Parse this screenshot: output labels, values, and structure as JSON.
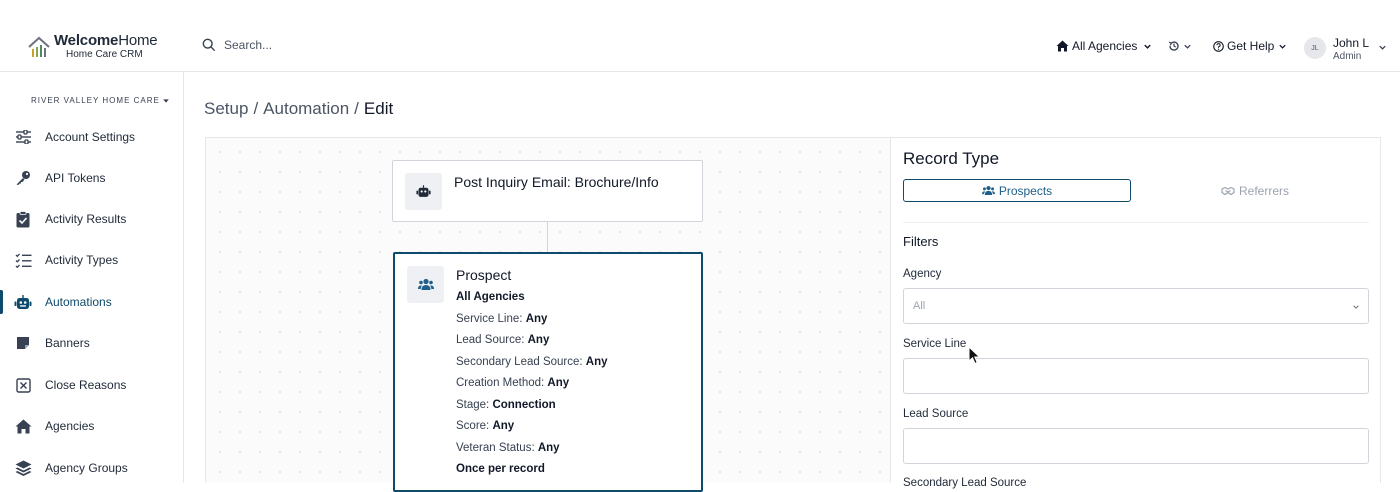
{
  "brand": {
    "name_bold": "Welcome",
    "name_rest": "Home",
    "tagline": "Home Care CRM"
  },
  "search": {
    "placeholder": "Search..."
  },
  "header": {
    "agency_selector": "All Agencies",
    "help_label": "Get Help",
    "user": {
      "initials": "JL",
      "name": "John L",
      "role": "Admin"
    }
  },
  "sidebar": {
    "org_name": "RIVER VALLEY HOME CARE",
    "items": [
      {
        "label": "Account Settings",
        "icon": "sliders-icon"
      },
      {
        "label": "API Tokens",
        "icon": "key-icon"
      },
      {
        "label": "Activity Results",
        "icon": "clipboard-check-icon"
      },
      {
        "label": "Activity Types",
        "icon": "list-check-icon"
      },
      {
        "label": "Automations",
        "icon": "robot-icon",
        "active": true
      },
      {
        "label": "Banners",
        "icon": "note-icon"
      },
      {
        "label": "Close Reasons",
        "icon": "close-box-icon"
      },
      {
        "label": "Agencies",
        "icon": "home-icon"
      },
      {
        "label": "Agency Groups",
        "icon": "layers-icon"
      }
    ]
  },
  "breadcrumb": {
    "items": [
      "Setup",
      "Automation",
      "Edit"
    ]
  },
  "flow": {
    "trigger_node": {
      "title": "Post Inquiry Email: Brochure/Info",
      "icon": "robot-icon"
    },
    "prospect_node": {
      "title": "Prospect",
      "subtitle": "All Agencies",
      "icon": "users-icon",
      "conditions": [
        {
          "label": "Service Line:",
          "value": "Any"
        },
        {
          "label": "Lead Source:",
          "value": "Any"
        },
        {
          "label": "Secondary Lead Source:",
          "value": "Any"
        },
        {
          "label": "Creation Method:",
          "value": "Any"
        },
        {
          "label": "Stage:",
          "value": "Connection"
        },
        {
          "label": "Score:",
          "value": "Any"
        },
        {
          "label": "Veteran Status:",
          "value": "Any"
        }
      ],
      "frequency": "Once per record"
    }
  },
  "panel": {
    "title": "Record Type",
    "record_types": {
      "prospects": "Prospects",
      "referrers": "Referrers"
    },
    "filters_heading": "Filters",
    "agency_label": "Agency",
    "agency_value": "All",
    "service_line_label": "Service Line",
    "lead_source_label": "Lead Source",
    "secondary_lead_source_label": "Secondary Lead Source"
  },
  "colors": {
    "accent": "#0e4a6b",
    "link": "#1d5f8a"
  }
}
